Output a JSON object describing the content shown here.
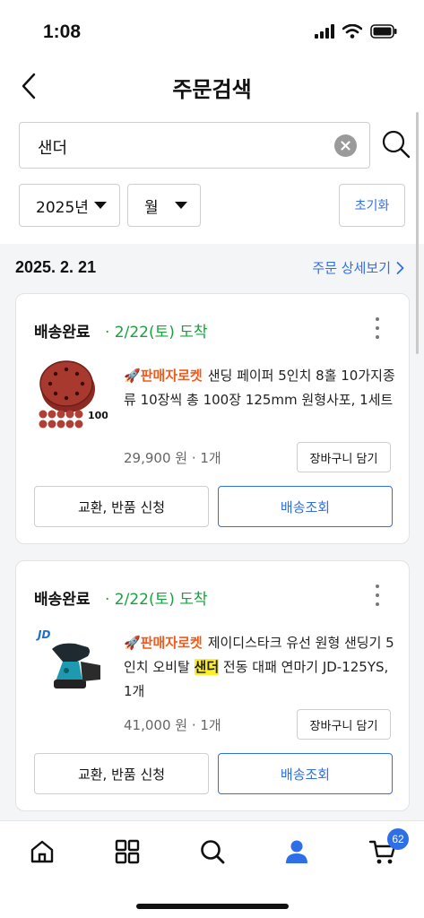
{
  "status_bar": {
    "time": "1:08"
  },
  "header": {
    "title": "주문검색",
    "back_icon": "chevron-left-icon"
  },
  "search": {
    "query": "샌더",
    "clear_icon": "clear-icon",
    "search_icon": "search-icon"
  },
  "filters": {
    "year": "2025년",
    "month": "월",
    "reset_label": "초기화"
  },
  "order_group": {
    "date": "2025. 2. 21",
    "detail_link": "주문 상세보기"
  },
  "orders": [
    {
      "status": "배송완료",
      "arrival": "· 2/22(토) 도착",
      "seller_badge": "판매자로켓",
      "product_name": "샌딩 페이퍼 5인치 8홀 10가지종류 10장씩 총 100장 125mm 원형사포, 1세트",
      "thumb_label": "100장",
      "price": "29,900 원 · 1개",
      "cart_label": "장바구니 담기",
      "exchange_label": "교환, 반품 신청",
      "track_label": "배송조회"
    },
    {
      "status": "배송완료",
      "arrival": "· 2/22(토) 도착",
      "seller_badge": "판매자로켓",
      "product_name_before": "제이디스타크 유선 원형 샌딩기 5인치 오비탈 ",
      "product_name_highlight": "샌더",
      "product_name_after": " 전동 대패 연마기 JD-125YS, 1개",
      "thumb_label": "JD",
      "price": "41,000 원 · 1개",
      "cart_label": "장바구니 담기",
      "exchange_label": "교환, 반품 신청",
      "track_label": "배송조회"
    }
  ],
  "bottom_nav": {
    "items": [
      "home-icon",
      "category-icon",
      "search-icon",
      "my-coupang-icon",
      "cart-icon"
    ],
    "cart_count": "62"
  },
  "colors": {
    "accent": "#2e6fe8",
    "arrival": "#1aa13f",
    "seller_badge": "#f05a1a",
    "highlight": "#ffef26"
  }
}
